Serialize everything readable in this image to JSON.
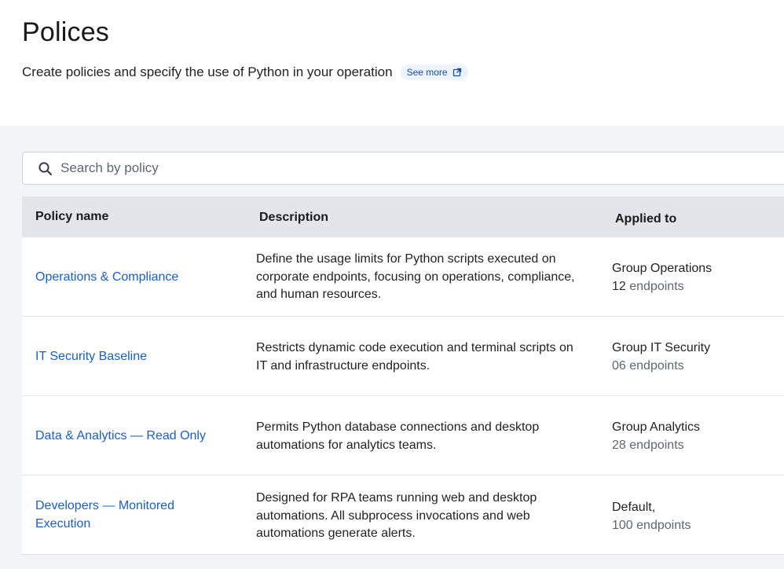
{
  "header": {
    "title": "Polices",
    "subtitle": "Create policies and specify the use of Python in your operation",
    "see_more_label": "See more",
    "see_more_icon": "external-link-icon"
  },
  "search": {
    "icon": "search-icon",
    "placeholder": "Search by policy",
    "value": ""
  },
  "table": {
    "columns": [
      "Policy name",
      "Description",
      "Applied to"
    ],
    "rows": [
      {
        "name": "Operations & Compliance",
        "description": "Define the usage limits for Python scripts executed on corporate endpoints, focusing on operations, compliance, and human resources.",
        "applied_group": "Group Operations",
        "endpoint_count": "12",
        "endpoint_unit": "endpoints"
      },
      {
        "name": "IT Security Baseline",
        "description": "Restricts dynamic code execution and terminal scripts on IT and infrastructure endpoints.",
        "applied_group": "Group IT Security",
        "endpoint_count": "06",
        "endpoint_unit": "endpoints"
      },
      {
        "name": "Data & Analytics — Read Only",
        "description": "Permits Python database connections and desktop automations for analytics teams.",
        "applied_group": "Group Analytics",
        "endpoint_count": "28",
        "endpoint_unit": "endpoints"
      },
      {
        "name": "Developers — Monitored Execution",
        "description": "Designed for RPA teams running web and desktop automations. All subprocess invocations and web automations generate  alerts.",
        "applied_group": "Default,",
        "endpoint_count": "100",
        "endpoint_unit": "endpoints"
      }
    ]
  },
  "colors": {
    "link": "#1b5fc2",
    "header_bg": "#e2e5e9",
    "content_bg": "#f3f4f6",
    "badge_bg": "#edf3fb"
  }
}
